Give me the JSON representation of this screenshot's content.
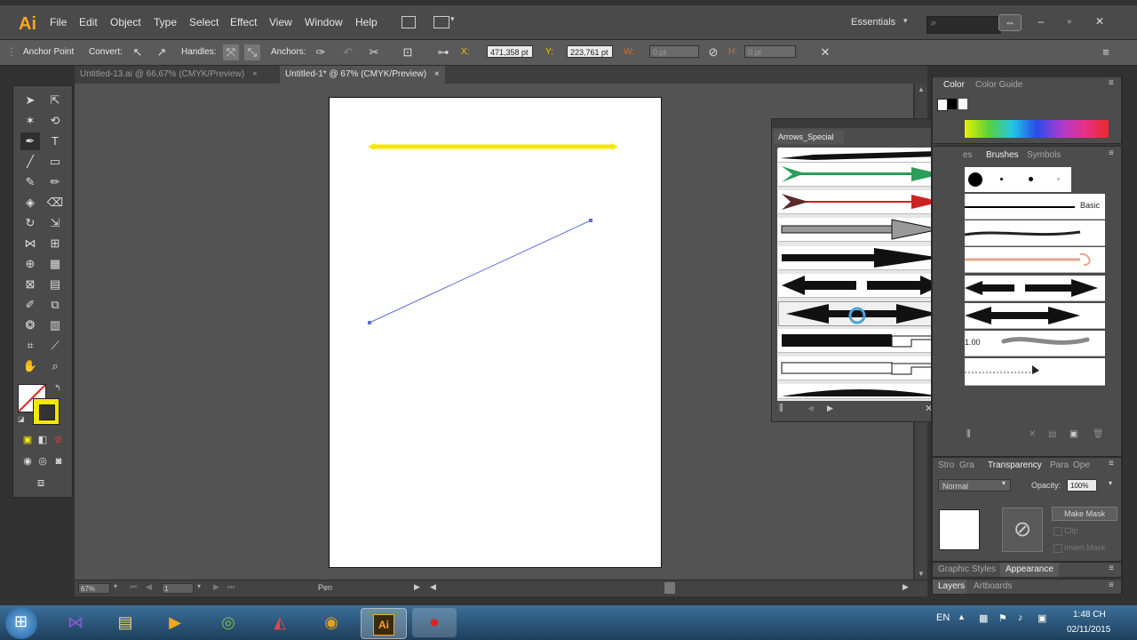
{
  "app": {
    "logo": "Ai"
  },
  "menu": [
    "File",
    "Edit",
    "Object",
    "Type",
    "Select",
    "Effect",
    "View",
    "Window",
    "Help"
  ],
  "workspace": "Essentials",
  "control": {
    "anchor_point": "Anchor Point",
    "convert": "Convert:",
    "handles": "Handles:",
    "anchors": "Anchors:",
    "x_label": "X:",
    "x_value": "471,358 pt",
    "y_label": "Y:",
    "y_value": "223,761 pt",
    "w_label": "W:",
    "w_value": "0 pt",
    "h_label": "H:",
    "h_value": "0 pt"
  },
  "tabs": [
    {
      "label": "Untitled-13.ai @ 66,67% (CMYK/Preview)"
    },
    {
      "label": "Untitled-1* @ 67% (CMYK/Preview)"
    }
  ],
  "status": {
    "zoom": "67%",
    "page": "1",
    "tool": "Pen"
  },
  "arrows_panel": {
    "title": "Arrows_Special"
  },
  "color_panel": {
    "tab1": "Color",
    "tab2": "Color Guide"
  },
  "brushes_panel": {
    "tab0": "es",
    "tab1": "Brushes",
    "tab2": "Symbols",
    "basic_label": "Basic",
    "stroke_value": "1.00"
  },
  "transparency_panel": {
    "tabs": [
      "Stro",
      "Gra",
      "Transparency",
      "Para",
      "Ope"
    ],
    "mode": "Normal",
    "opacity_label": "Opacity:",
    "opacity_value": "100%",
    "make_mask": "Make Mask",
    "clip": "Clip",
    "invert_mask": "Invert Mask"
  },
  "bottom_tabs": {
    "graphic_styles": "Graphic Styles",
    "appearance": "Appearance",
    "layers": "Layers",
    "artboards": "Artboards"
  },
  "tray": {
    "lang": "EN",
    "time": "1:48 CH",
    "date": "02/11/2015"
  },
  "colors": {
    "accent_yellow": "#f5e800",
    "path_blue": "#5d6fd8",
    "ai_orange": "#f6a623"
  }
}
